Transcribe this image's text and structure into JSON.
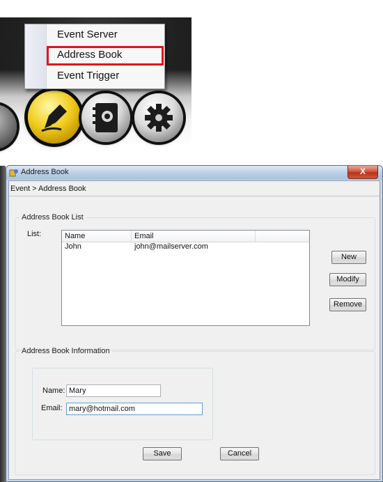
{
  "toolbar": {
    "buttons": [
      {
        "name": "event",
        "icon": "pen-icon"
      },
      {
        "name": "record",
        "icon": "notebook-icon"
      },
      {
        "name": "setting",
        "icon": "gear-icon"
      }
    ]
  },
  "popup_menu": {
    "items": [
      {
        "label": "Event Server"
      },
      {
        "label": "Address Book",
        "highlighted": true
      },
      {
        "label": "Event Trigger"
      }
    ],
    "highlight_color": "#e0141b"
  },
  "dialog": {
    "title": "Address Book",
    "close_label": "X",
    "breadcrumb": "Event > Address Book",
    "list_group": {
      "legend": "Address Book List",
      "list_label": "List:",
      "columns": [
        "Name",
        "Email",
        ""
      ],
      "rows": [
        {
          "name": "John",
          "email": "john@mailserver.com"
        }
      ],
      "buttons": {
        "new": "New",
        "modify": "Modify",
        "remove": "Remove"
      }
    },
    "info_group": {
      "legend": "Address Book Information",
      "name_label": "Name:",
      "name_value": "Mary",
      "email_label": "Email:",
      "email_value": "mary@hotmail.com"
    },
    "footer": {
      "save": "Save",
      "cancel": "Cancel"
    }
  }
}
